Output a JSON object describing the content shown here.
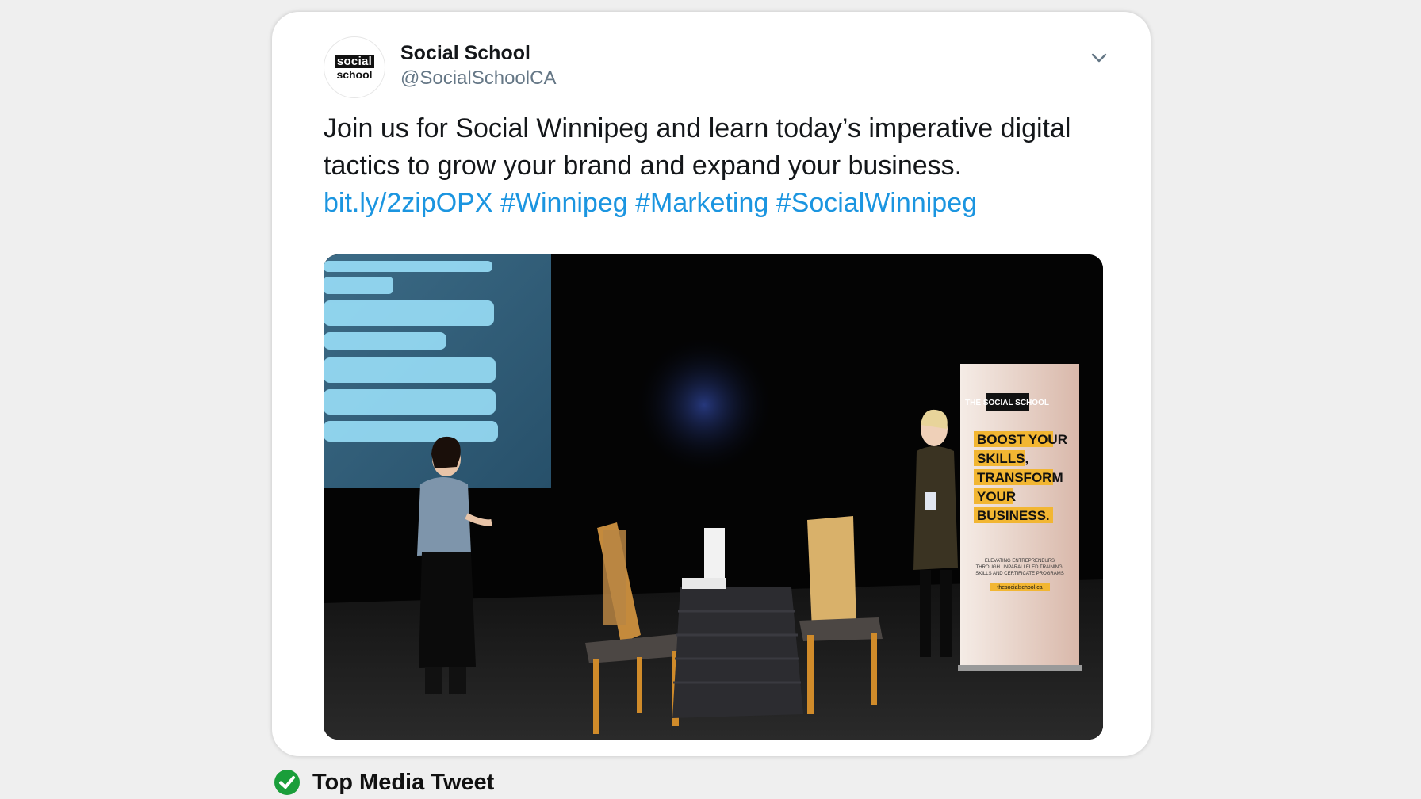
{
  "tweet": {
    "logo_top": "social",
    "logo_bottom": "school",
    "author_name": "Social School",
    "author_handle": "@SocialSchoolCA",
    "text_line1": "Join us for Social Winnipeg and learn today’s imperative digital",
    "text_line2": "tactics to grow your brand and expand your business.",
    "link": "bit.ly/2zipOPX",
    "hashtag1": "#Winnipeg",
    "hashtag2": "#Marketing",
    "hashtag3": "#SocialWinnipeg",
    "more_icon": "chevron-down-icon"
  },
  "media": {
    "banner_logo": "THE SOCIAL SCHOOL",
    "banner_lines": [
      "BOOST YOUR",
      "SKILLS,",
      "TRANSFORM",
      "YOUR",
      "BUSINESS."
    ],
    "banner_subtext": [
      "ELEVATING ENTREPRENEURS",
      "THROUGH UNPARALLELED TRAINING,",
      "SKILLS AND CERTIFICATE PROGRAMS"
    ],
    "banner_url": "thesocialschool.ca"
  },
  "footer": {
    "icon": "check-circle-icon",
    "label": "Top Media Tweet"
  },
  "colors": {
    "link": "#1b95e0",
    "check": "#1a9e3a",
    "banner_yellow": "#f2b632"
  }
}
